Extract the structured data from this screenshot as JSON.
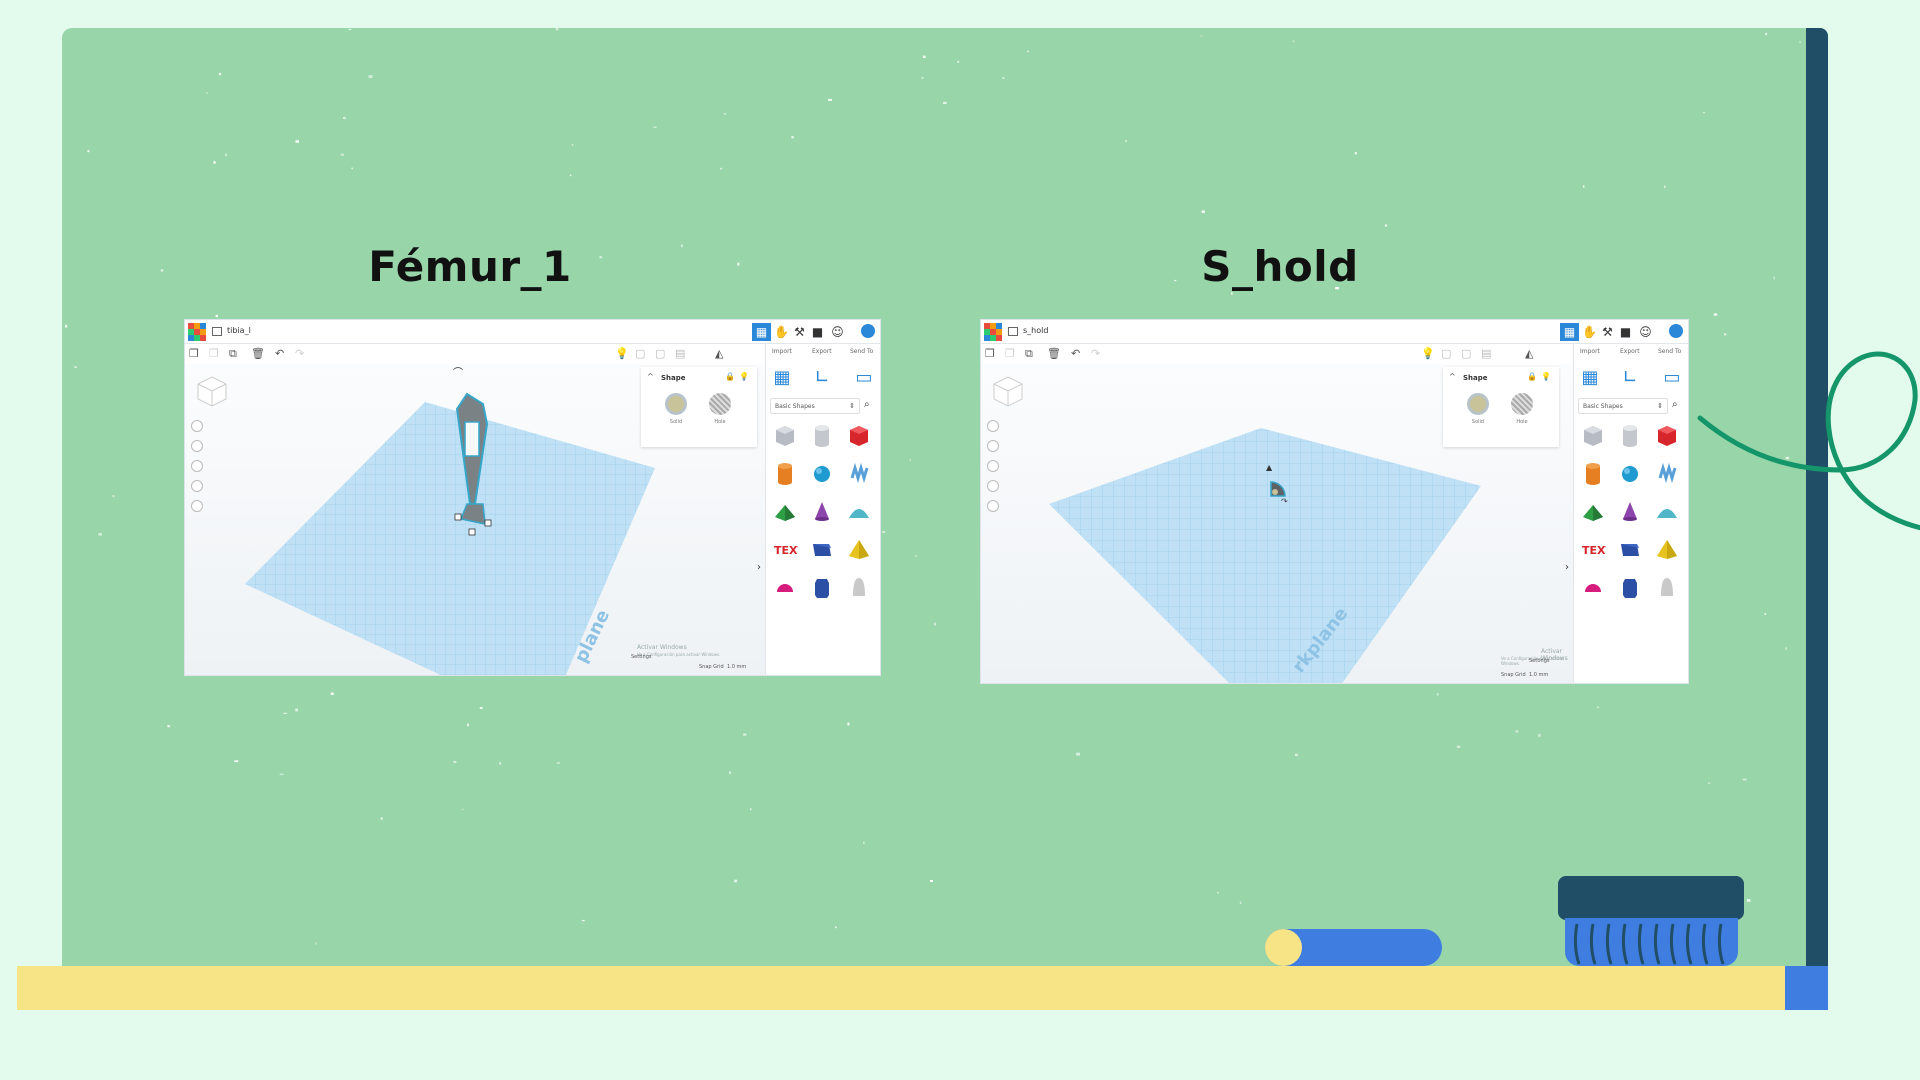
{
  "slide": {
    "left_title": "Fémur_1",
    "right_title": "S_hold"
  },
  "colors": {
    "background": "#e2fbec",
    "board": "#98d5a9",
    "board_edge": "#1f4e66",
    "ledge": "#f6e487",
    "accent_blue": "#3f7ee0",
    "loop_green": "#15966a",
    "tinkercad_blue": "#2b87d8"
  },
  "screenshots": [
    {
      "project_name": "tibia_l",
      "header_icons": [
        "grid-icon",
        "hand-icon",
        "hammer-icon",
        "suitcase-icon",
        "user-add-icon"
      ],
      "panel_tabs": [
        "Import",
        "Export",
        "Send To"
      ],
      "inspector": {
        "title": "Shape",
        "solid_label": "Solid",
        "hole_label": "Hole"
      },
      "shape_category": "Basic Shapes",
      "workplane_label": "plane",
      "watermark_line1": "Activar Windows",
      "watermark_line2": "Ve a Configuración para activar Windows.",
      "settings_label": "Settings",
      "snap_grid_label": "Snap Grid",
      "snap_grid_value": "1.0 mm"
    },
    {
      "project_name": "s_hold",
      "header_icons": [
        "grid-icon",
        "hand-icon",
        "hammer-icon",
        "suitcase-icon",
        "user-add-icon"
      ],
      "panel_tabs": [
        "Import",
        "Export",
        "Send To"
      ],
      "inspector": {
        "title": "Shape",
        "solid_label": "Solid",
        "hole_label": "Hole"
      },
      "shape_category": "Basic Shapes",
      "workplane_label": "rkplane",
      "watermark_line1": "Activar Windows",
      "watermark_line2": "Ve a Configuración para activar Windows.",
      "settings_label": "Settings",
      "snap_grid_label": "Snap Grid",
      "snap_grid_value": "1.0 mm"
    }
  ],
  "basic_shapes": [
    {
      "name": "box-striped",
      "color": "#b7bcc4"
    },
    {
      "name": "cylinder-striped",
      "color": "#c4c8ce"
    },
    {
      "name": "box",
      "color": "#d7262b"
    },
    {
      "name": "cylinder",
      "color": "#e67e22"
    },
    {
      "name": "sphere",
      "color": "#1f9bd1"
    },
    {
      "name": "scribble",
      "color": "#5aa0d8"
    },
    {
      "name": "roof",
      "color": "#2e9e44"
    },
    {
      "name": "cone",
      "color": "#8e44ad"
    },
    {
      "name": "round-roof",
      "color": "#52b6c9"
    },
    {
      "name": "text",
      "color": "#d7262b"
    },
    {
      "name": "wedge",
      "color": "#2c4fa6"
    },
    {
      "name": "pyramid",
      "color": "#e6c21f"
    },
    {
      "name": "half-sphere",
      "color": "#d61d7d"
    },
    {
      "name": "polygon",
      "color": "#2c4fa6"
    },
    {
      "name": "paraboloid",
      "color": "#c9c9c9"
    }
  ]
}
